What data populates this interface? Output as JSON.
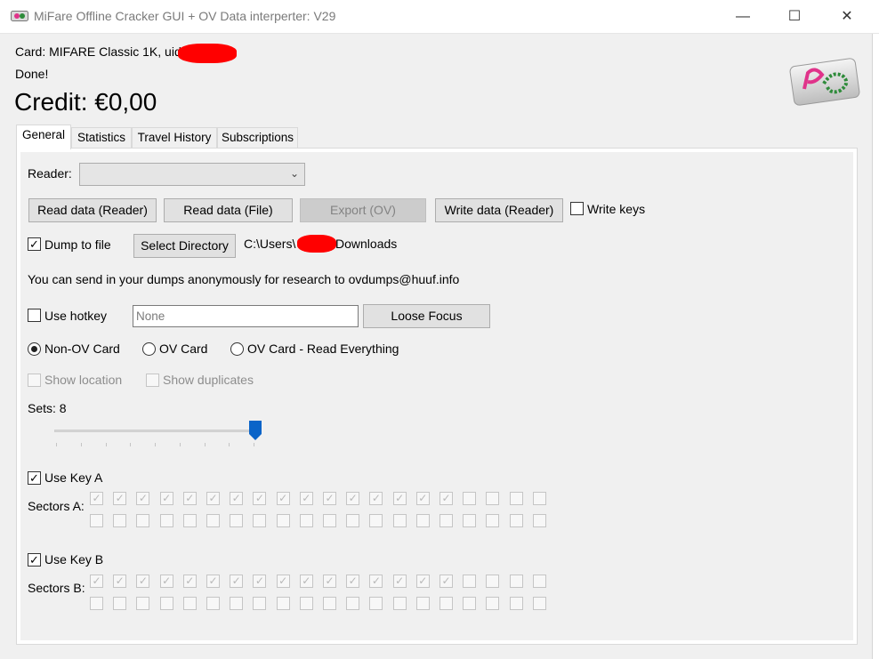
{
  "window": {
    "title": "MiFare Offline Cracker GUI + OV Data interperter: V29",
    "minimize_glyph": "—",
    "maximize_glyph": "☐",
    "close_glyph": "✕"
  },
  "header": {
    "card_info": "Card: MIFARE Classic 1K, uid:",
    "status": "Done!",
    "credit": "Credit: €0,00"
  },
  "tabs": [
    {
      "label": "General",
      "active": true
    },
    {
      "label": "Statistics",
      "active": false
    },
    {
      "label": "Travel History",
      "active": false
    },
    {
      "label": "Subscriptions",
      "active": false
    }
  ],
  "general": {
    "reader_label": "Reader:",
    "reader_value": "",
    "read_reader_button": "Read data (Reader)",
    "read_file_button": "Read data (File)",
    "export_button": "Export (OV)",
    "write_reader_button": "Write data (Reader)",
    "write_keys_label": "Write keys",
    "write_keys_checked": false,
    "dump_to_file_label": "Dump to file",
    "dump_to_file_checked": true,
    "select_directory_button": "Select Directory",
    "path_prefix": "C:\\Users\\",
    "path_suffix": "Downloads",
    "research_note": "You can send in your dumps anonymously for research to ovdumps@huuf.info",
    "use_hotkey_label": "Use hotkey",
    "use_hotkey_checked": false,
    "hotkey_placeholder": "None",
    "loose_focus_button": "Loose Focus",
    "radio_non_ov": "Non-OV Card",
    "radio_ov": "OV Card",
    "radio_ov_all": "OV Card - Read Everything",
    "selected_mode": "Non-OV Card",
    "show_location_label": "Show location",
    "show_duplicates_label": "Show duplicates",
    "sets_label": "Sets: 8",
    "sets_value": 8,
    "sets_max": 8,
    "use_key_a_label": "Use Key A",
    "use_key_a_checked": true,
    "sectors_a_label": "Sectors A:",
    "use_key_b_label": "Use Key B",
    "use_key_b_checked": true,
    "sectors_b_label": "Sectors B:",
    "sectors_a_checked": [
      true,
      true,
      true,
      true,
      true,
      true,
      true,
      true,
      true,
      true,
      true,
      true,
      true,
      true,
      true,
      true,
      false,
      false,
      false,
      false,
      false,
      false,
      false,
      false,
      false,
      false,
      false,
      false,
      false,
      false,
      false,
      false,
      false,
      false,
      false,
      false,
      false,
      false,
      false,
      false
    ],
    "sectors_b_checked": [
      true,
      true,
      true,
      true,
      true,
      true,
      true,
      true,
      true,
      true,
      true,
      true,
      true,
      true,
      true,
      true,
      false,
      false,
      false,
      false,
      false,
      false,
      false,
      false,
      false,
      false,
      false,
      false,
      false,
      false,
      false,
      false,
      false,
      false,
      false,
      false,
      false,
      false,
      false,
      false
    ],
    "check_glyph": "✓"
  },
  "colors": {
    "slider_thumb": "#0a64c8",
    "redaction": "#ff0000",
    "logo_pink": "#e0338a",
    "logo_green": "#2e8b3a"
  }
}
